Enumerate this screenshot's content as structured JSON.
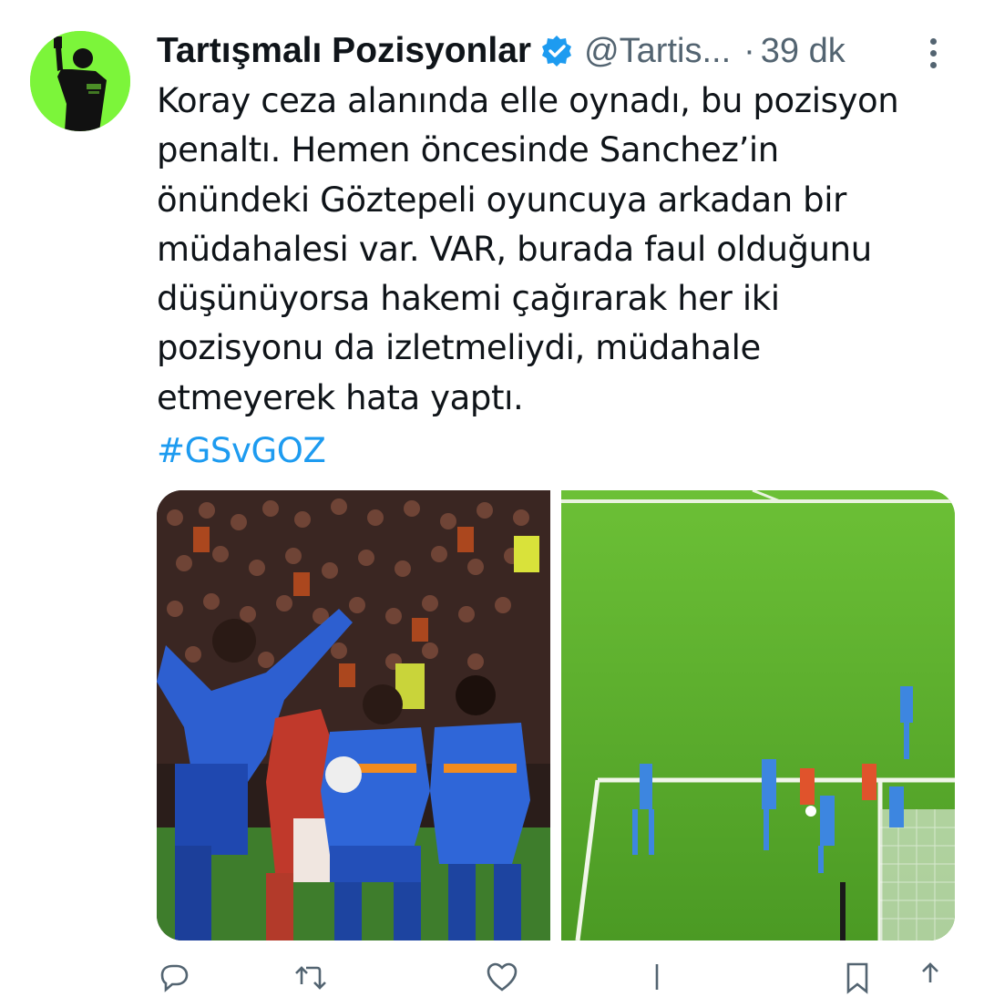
{
  "tweet": {
    "display_name": "Tartışmalı Pozisyonlar",
    "handle": "@Tartis...",
    "separator": "·",
    "time": "39 dk",
    "text_lines": [
      "Koray ceza alanında elle oynadı, bu pozisyon",
      "penaltı. Hemen öncesinde Sanchez’in",
      "önündeki Göztepeli oyuncuya arkadan bir",
      "müdahalesi var. VAR, burada faul olduğunu",
      "düşünüyorsa hakemi çağırarak her iki",
      "pozisyonu da izletmeliydi, müdahale",
      "etmeyerek hata yaptı."
    ],
    "hashtag": "#GSvGOZ",
    "media": [
      {
        "icon": "photo-players-handball"
      },
      {
        "icon": "photo-penalty-area-wide"
      }
    ]
  },
  "colors": {
    "accent": "#1d9bf0",
    "avatar_bg": "#7cf53a",
    "secondary_text": "#536471"
  },
  "actions": {
    "reply_icon": "reply-icon",
    "retweet_icon": "retweet-icon",
    "like_icon": "heart-icon",
    "views_icon": "views-icon",
    "bookmark_icon": "bookmark-icon",
    "share_icon": "share-icon"
  }
}
